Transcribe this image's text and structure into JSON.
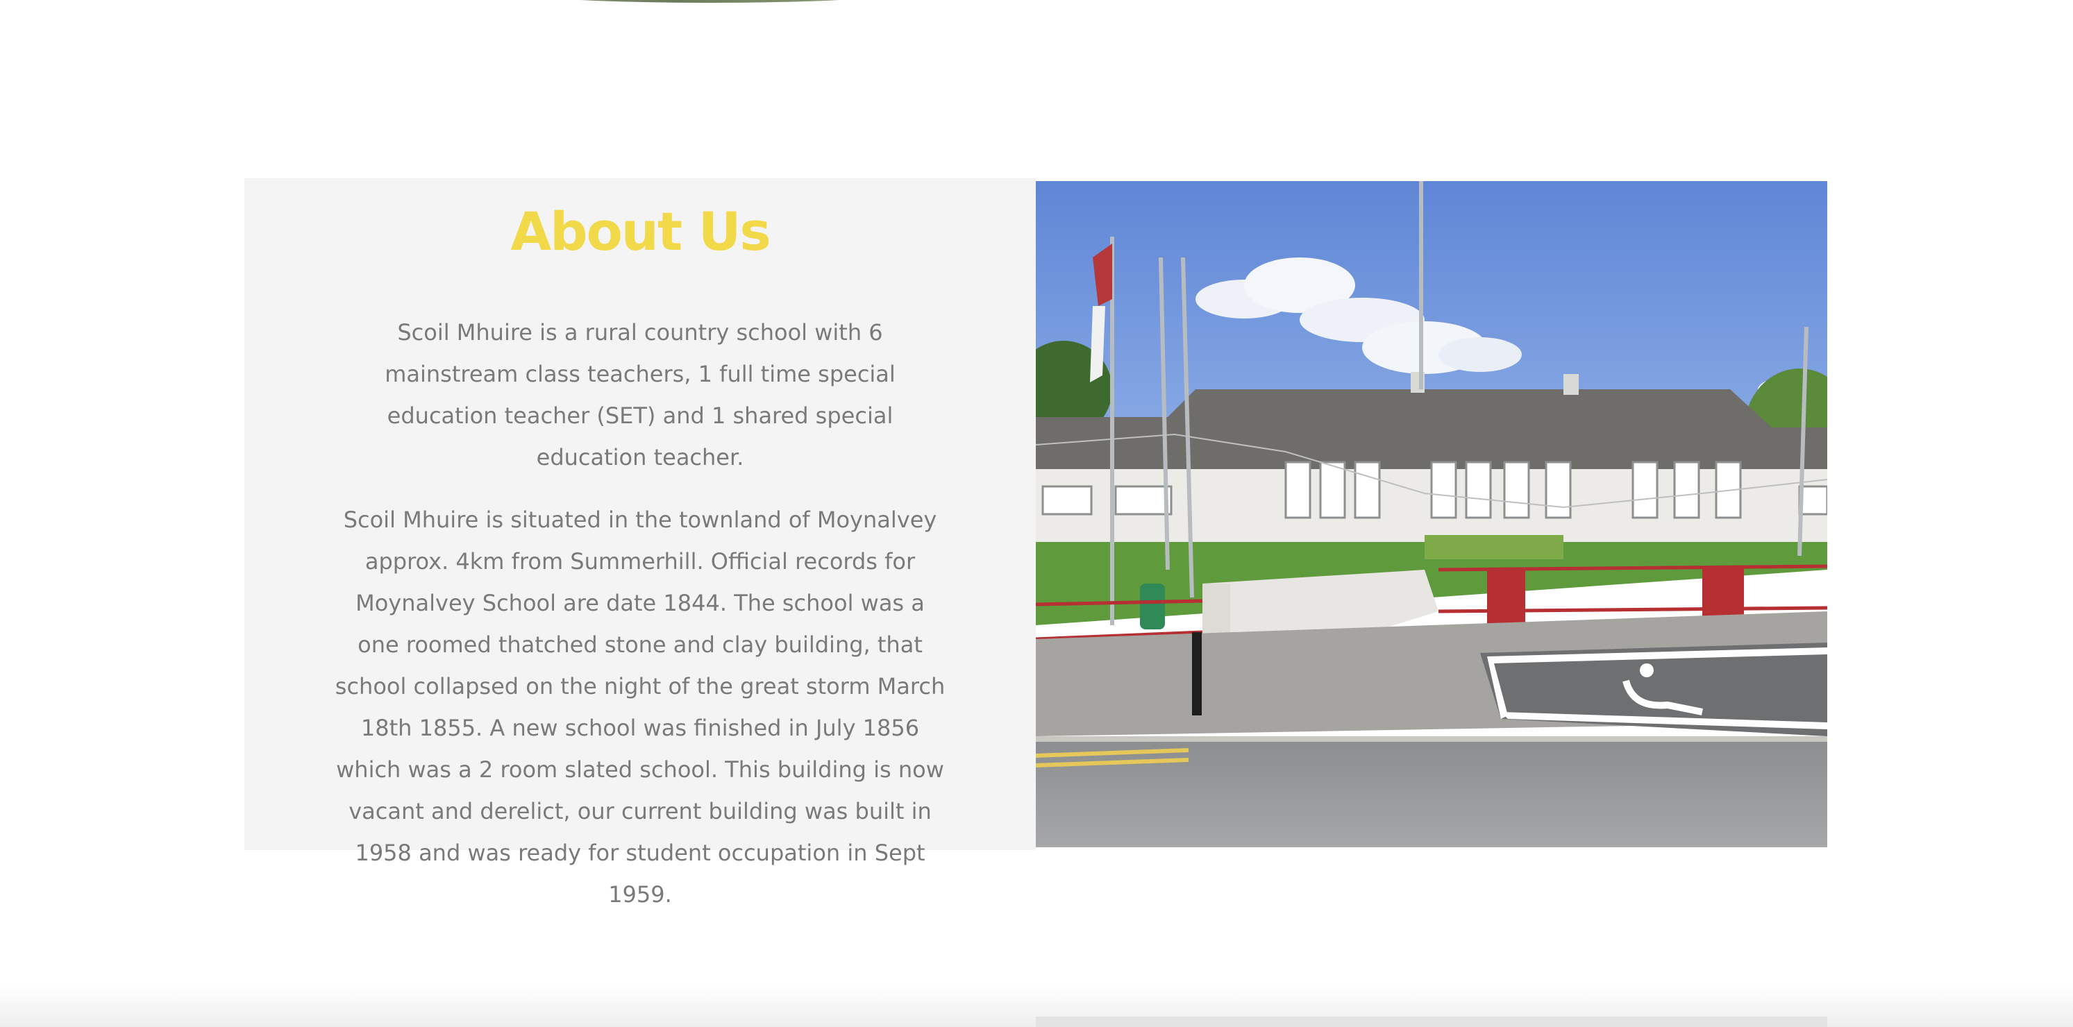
{
  "about": {
    "title": "About Us",
    "paragraphs": [
      "Scoil Mhuire is a rural country school with 6 mainstream class teachers, 1 full time special education teacher (SET) and 1 shared special education teacher.",
      "Scoil Mhuire is situated in the townland of Moynalvey approx. 4km from Summerhill. Official records for Moynalvey School are date 1844. The school was a one roomed thatched stone and clay building, that school collapsed on the night of the great storm March 18th 1855. A new school was finished in July 1856 which was a 2 room slated school. This building is now vacant and derelict, our current building was built in 1958 and was ready for student occupation in Sept 1959."
    ],
    "title_color": "#f2d94a",
    "panel_color": "#f4f4f4",
    "text_color": "#7a7a7a"
  }
}
